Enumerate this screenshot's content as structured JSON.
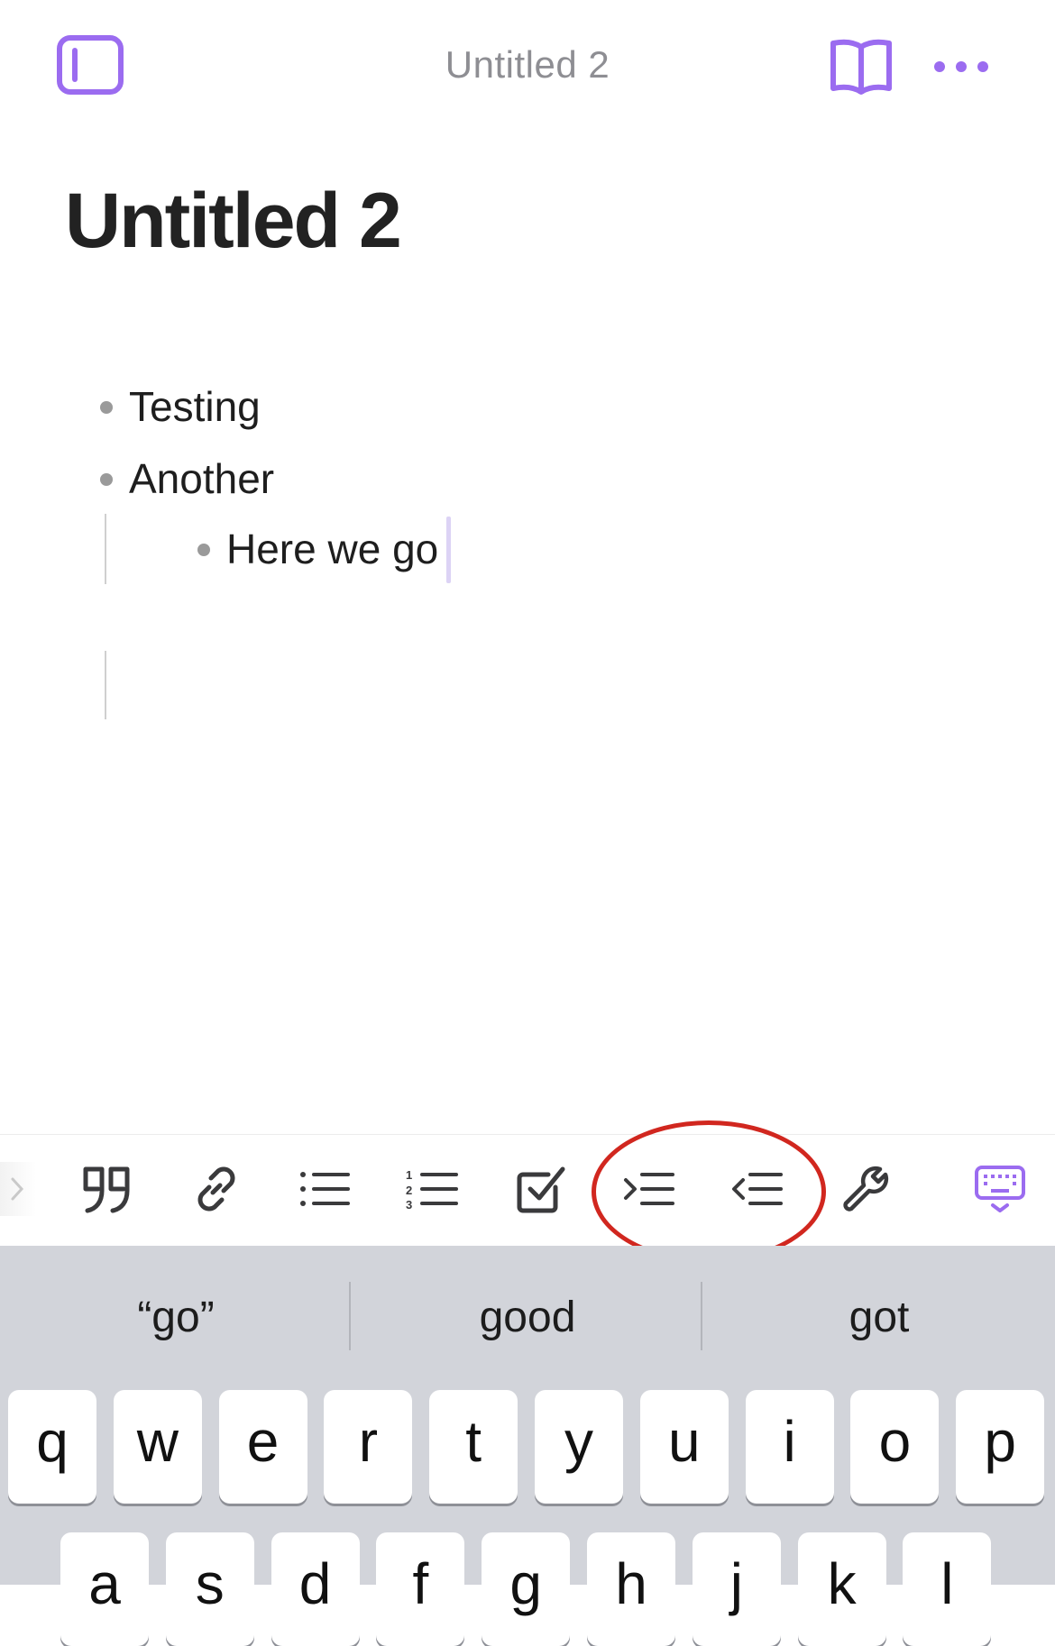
{
  "header": {
    "title": "Untitled 2",
    "sidebar_icon": "sidebar-toggle-icon",
    "reading_icon": "book-icon",
    "more_icon": "more-horizontal-icon",
    "accent_color": "#9b6cf0"
  },
  "document": {
    "title": "Untitled 2",
    "items": [
      {
        "text": "Testing",
        "level": 0
      },
      {
        "text": "Another",
        "level": 0
      },
      {
        "text": "Here we go",
        "level": 1
      }
    ]
  },
  "toolbar": {
    "buttons": [
      {
        "name": "expand-chevron-icon"
      },
      {
        "name": "blockquote-icon"
      },
      {
        "name": "link-icon"
      },
      {
        "name": "bullet-list-icon"
      },
      {
        "name": "numbered-list-icon"
      },
      {
        "name": "checkbox-icon"
      },
      {
        "name": "indent-icon"
      },
      {
        "name": "outdent-icon"
      },
      {
        "name": "wrench-icon"
      },
      {
        "name": "hide-keyboard-icon"
      }
    ],
    "highlight_color": "#d1271f"
  },
  "keyboard": {
    "suggestions": [
      "“go”",
      "good",
      "got"
    ],
    "row1": [
      "q",
      "w",
      "e",
      "r",
      "t",
      "y",
      "u",
      "i",
      "o",
      "p"
    ],
    "row2": [
      "a",
      "s",
      "d",
      "f",
      "g",
      "h",
      "j",
      "k",
      "l"
    ]
  }
}
